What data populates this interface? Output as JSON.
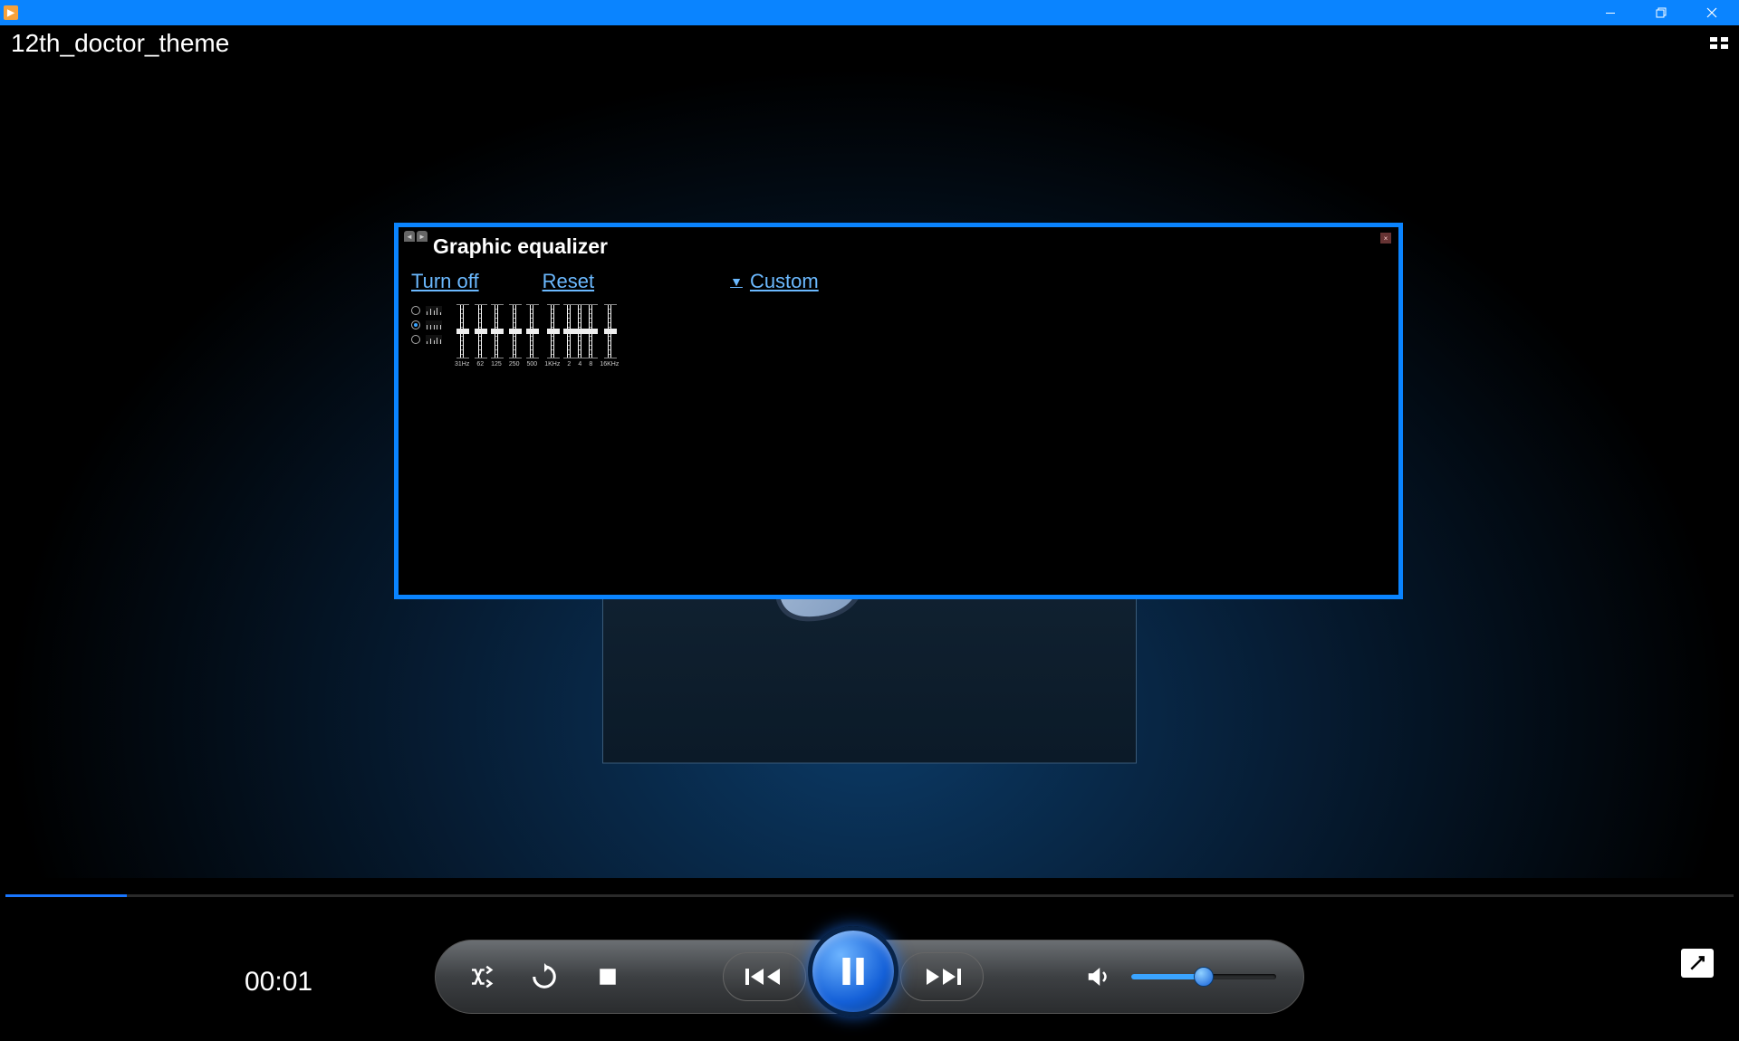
{
  "window": {
    "minimize_tooltip": "Minimize",
    "maximize_tooltip": "Restore Down",
    "close_tooltip": "Close"
  },
  "player": {
    "track_title": "12th_doctor_theme",
    "elapsed_time": "00:01",
    "progress_percent": 7,
    "volume_percent": 50,
    "is_paused": false
  },
  "controls": {
    "shuffle_tooltip": "Turn shuffle on",
    "repeat_tooltip": "Turn repeat on",
    "stop_tooltip": "Stop",
    "previous_tooltip": "Previous",
    "playpause_tooltip": "Pause",
    "next_tooltip": "Next",
    "mute_tooltip": "Mute",
    "fullscreen_tooltip": "View full screen",
    "library_tooltip": "Switch to Library"
  },
  "equalizer": {
    "title": "Graphic equalizer",
    "turn_off_label": "Turn off",
    "reset_label": "Reset",
    "preset_label": "Custom",
    "selected_scope": 1,
    "bands": [
      {
        "freq": "31Hz",
        "value": 0
      },
      {
        "freq": "62",
        "value": 0
      },
      {
        "freq": "125",
        "value": 0
      },
      {
        "freq": "250",
        "value": 0
      },
      {
        "freq": "500",
        "value": 0
      },
      {
        "freq": "1KHz",
        "value": 0
      },
      {
        "freq": "2",
        "value": 0
      },
      {
        "freq": "4",
        "value": 0
      },
      {
        "freq": "8",
        "value": 0
      },
      {
        "freq": "16KHz",
        "value": 0
      }
    ]
  }
}
